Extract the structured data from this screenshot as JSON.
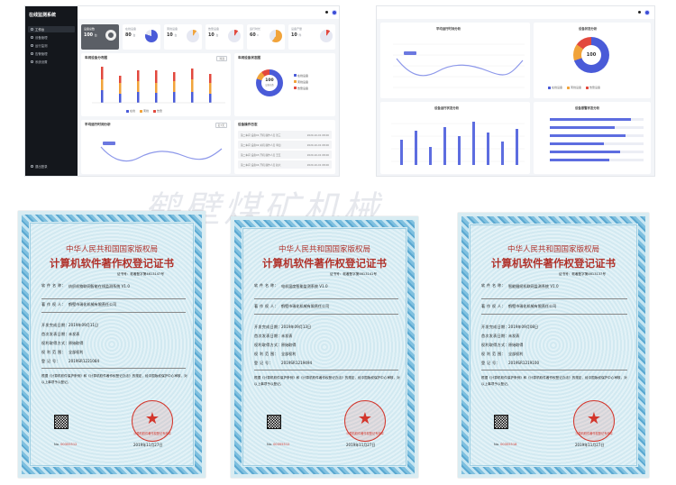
{
  "dash1": {
    "brand": "在线监测系统",
    "nav": [
      "工作台",
      "设备管理",
      "运行监测",
      "告警管理",
      "系统设置"
    ],
    "footer": "退出登录",
    "kpis": [
      {
        "label": "设备总数",
        "value": "100",
        "unit": "台"
      },
      {
        "label": "在线设备",
        "value": "80",
        "unit": "台"
      },
      {
        "label": "离线设备",
        "value": "10",
        "unit": "台"
      },
      {
        "label": "告警设备",
        "value": "10",
        "unit": "台"
      },
      {
        "label": "运行时长",
        "value": "60",
        "unit": "h"
      },
      {
        "label": "设备产量",
        "value": "10",
        "unit": "件"
      }
    ],
    "bar_panel": {
      "title": "车间设备分布图",
      "pill": "筛选"
    },
    "pie_panel": {
      "title": "车间设备状态图",
      "center_value": "100",
      "center_label": "设备总数",
      "legend": [
        "在线设备",
        "离线设备",
        "告警设备"
      ]
    },
    "line_panel": {
      "title": "平均运行时间分析",
      "pill": "近7天"
    },
    "log_panel": {
      "title": "设备操作日志",
      "rows": [
        {
          "text": "第二车间 设备01 开机 操作人员 张三",
          "time": "2020-10-01 08:00"
        },
        {
          "text": "第二车间 设备02 关机 操作人员 李四",
          "time": "2020-10-01 08:00"
        },
        {
          "text": "第二车间 设备03 开机 操作人员 王五",
          "time": "2020-10-01 08:00"
        },
        {
          "text": "第二车间 设备04 开机 操作人员 赵六",
          "time": "2020-10-01 08:00"
        }
      ]
    },
    "bar_legend": [
      "在线",
      "离线",
      "告警"
    ]
  },
  "dash2": {
    "line_title": "平均运行时间分析",
    "pie_title": "设备状态分析",
    "pie_center": "100",
    "pie_legend": [
      "在线设备",
      "离线设备",
      "告警设备"
    ],
    "bar_title": "设备运行状态分析",
    "hbar_title": "设备报警状态分析"
  },
  "certificates": [
    {
      "authority": "中华人民共和国国家版权局",
      "title": "计算机软件著作权登记证书",
      "number": "证书号：软著登字第4613147号",
      "software_name": "纺织机物联网智能在线监测系统 V1.0",
      "owner": "鹤壁市瑞化机械有限责任公司",
      "develop_date": "2019年09月11日",
      "publish_status": "未发表",
      "acquire": "原始取得",
      "scope": "全部权利",
      "reg_no": "2019SR1221084",
      "serial": "00355512",
      "issue_date": "2019年11月27日"
    },
    {
      "authority": "中华人民共和国国家版权局",
      "title": "计算机软件著作权登记证书",
      "number": "证书号：软著登字第4613141号",
      "software_name": "电机温度智能监测系统 V1.0",
      "owner": "鹤壁市瑞化机械有限责任公司",
      "develop_date": "2019年09月13日",
      "publish_status": "未发表",
      "acquire": "原始取得",
      "scope": "全部权利",
      "reg_no": "2019SR1219494",
      "serial": "00355512",
      "issue_date": "2019年11月27日"
    },
    {
      "authority": "中华人民共和国国家版权局",
      "title": "计算机软件著作权登记证书",
      "number": "证书号：软著登字第4613137号",
      "software_name": "智能缝纫机联网监测系统 V1.0",
      "owner": "鹤壁市瑞化机械有限责任公司",
      "develop_date": "2019年09月08日",
      "publish_status": "未发表",
      "acquire": "原始取得",
      "scope": "全部权利",
      "reg_no": "2019SR1219100",
      "serial": "00355518",
      "issue_date": "2019年11月27日"
    }
  ],
  "labels": {
    "software_name": "软 件 名 称：",
    "owner": "著 作 权 人：",
    "develop_date": "开发完成日期：",
    "publish_status": "首次发表日期：",
    "acquire": "权利取得方式：",
    "scope": "权 利 范 围：",
    "reg_no": "登 记 号："
  },
  "cert_paragraph": "根据《计算机软件保护条例》和《计算机软件著作权登记办法》的规定，经中国版权保护中心审核，对以上事项予以登记。",
  "seal_text": "计算机软件著作权登记专用章",
  "serial_prefix": "No.",
  "watermark": "鹤壁煤矿机械"
}
